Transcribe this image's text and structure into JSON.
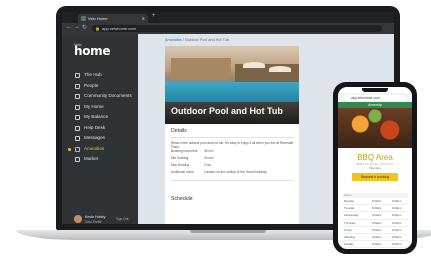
{
  "browser": {
    "tab_title": "Velo Home",
    "url": "app.velohome.com"
  },
  "sidebar": {
    "brand_small": "Velo",
    "brand": "home",
    "items": [
      {
        "label": "The Hub"
      },
      {
        "label": "People"
      },
      {
        "label": "Community Documents"
      },
      {
        "label": "My Home"
      },
      {
        "label": "My Balance"
      },
      {
        "label": "Help Desk"
      },
      {
        "label": "Messages"
      },
      {
        "label": "Amenities",
        "active": true
      },
      {
        "label": "Market"
      }
    ],
    "profile": {
      "name": "Kevin Hobby",
      "subtitle": "View Profile",
      "logout": "Sign Out"
    }
  },
  "main": {
    "breadcrumb_link": "Amenities",
    "breadcrumb_current": "Outdoor Pool and Hot Tub",
    "title": "Outdoor Pool and Hot Tub",
    "details_heading": "Details",
    "lead": "Relax in the outdoor pool and hot tub. It's easy to enjoy it all when you live at Riverside Place.",
    "details": [
      {
        "key": "Booking increment",
        "value": "30 min"
      },
      {
        "key": "Min booking",
        "value": "30 min"
      },
      {
        "key": "Max booking",
        "value": "2 hrs"
      },
      {
        "key": "Additional notes",
        "value": "Located on the rooftop of the Grand building"
      }
    ],
    "schedule_heading": "Schedule"
  },
  "phone": {
    "url": "app.velohome.com",
    "header": "Amenity",
    "title": "BBQ Area",
    "subtitle": "Books 1 hr per slot · 30 min min",
    "link": "View rules",
    "button": "Request a booking",
    "schedule_header": "Hours",
    "schedule": [
      {
        "day": "Monday",
        "open": "9:00am",
        "close": "9:00pm"
      },
      {
        "day": "Tuesday",
        "open": "9:00am",
        "close": "9:00pm"
      },
      {
        "day": "Wednesday",
        "open": "9:00am",
        "close": "9:00pm"
      },
      {
        "day": "Thursday",
        "open": "9:00am",
        "close": "9:00pm"
      },
      {
        "day": "Friday",
        "open": "9:00am",
        "close": "9:00pm",
        "today": true
      },
      {
        "day": "Saturday",
        "open": "9:00am",
        "close": "9:00pm"
      },
      {
        "day": "Sunday",
        "open": "9:00am",
        "close": "9:00pm"
      }
    ]
  },
  "colors": {
    "accent": "#f3c21b",
    "sidebar": "#2f3336",
    "brand_green": "#2f8a4f"
  }
}
